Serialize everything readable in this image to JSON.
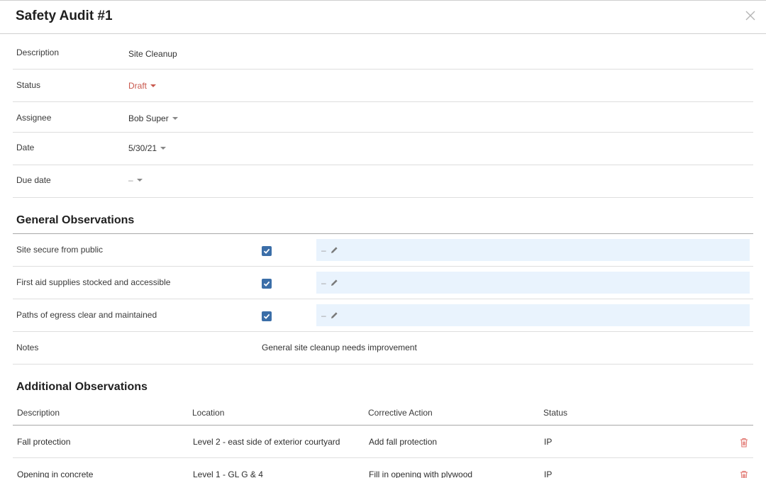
{
  "modal": {
    "title": "Safety Audit #1"
  },
  "fields": {
    "description": {
      "label": "Description",
      "value": "Site Cleanup"
    },
    "status": {
      "label": "Status",
      "value": "Draft"
    },
    "assignee": {
      "label": "Assignee",
      "value": "Bob Super"
    },
    "date": {
      "label": "Date",
      "value": "5/30/21"
    },
    "due_date": {
      "label": "Due date",
      "value": "–"
    }
  },
  "general": {
    "title": "General Observations",
    "items": [
      {
        "label": "Site secure from public",
        "checked": true,
        "comment": "–"
      },
      {
        "label": "First aid supplies stocked and accessible",
        "checked": true,
        "comment": "–"
      },
      {
        "label": "Paths of egress clear and maintained",
        "checked": true,
        "comment": "–"
      }
    ],
    "notes": {
      "label": "Notes",
      "value": "General site cleanup needs improvement"
    }
  },
  "additional": {
    "title": "Additional Observations",
    "columns": [
      "Description",
      "Location",
      "Corrective Action",
      "Status"
    ],
    "rows": [
      [
        "Fall protection",
        "Level 2 - east side of exterior courtyard",
        "Add fall protection",
        "IP"
      ],
      [
        "Opening in concrete",
        "Level 1 - GL G & 4",
        "Fill in opening with plywood",
        "IP"
      ]
    ]
  },
  "colors": {
    "status_draft": "#c9584d",
    "checkbox": "#3b6ea8",
    "comment_bg": "#e9f3fd",
    "trash": "#e0706a"
  },
  "icons": [
    "close-icon",
    "caret-down-icon",
    "checkmark-icon",
    "pencil-icon",
    "trash-icon"
  ]
}
